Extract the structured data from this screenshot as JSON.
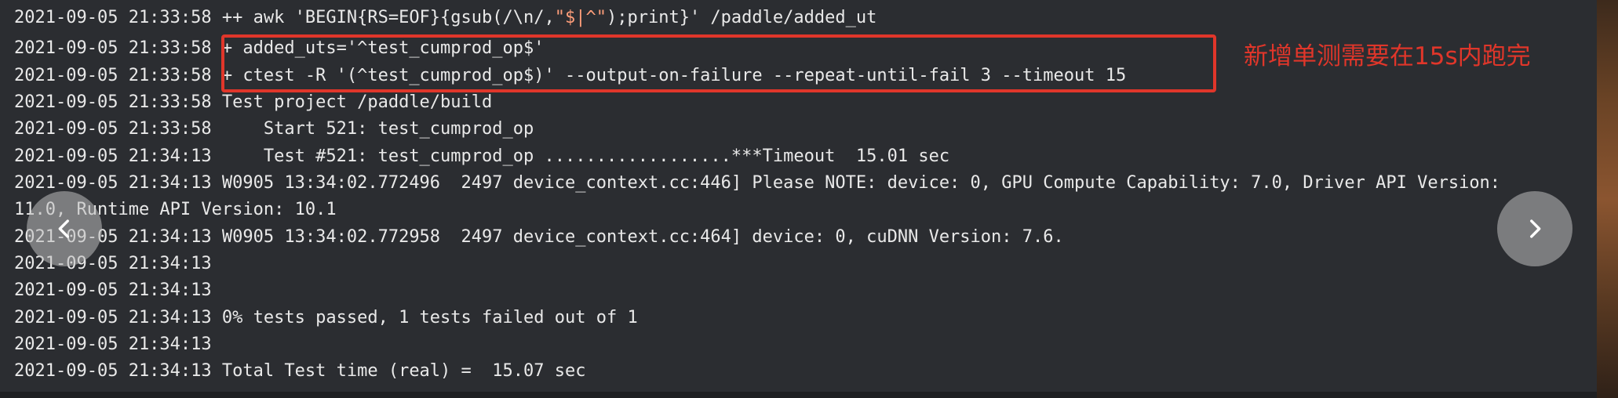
{
  "terminal": {
    "lines": [
      {
        "pre": "2021-09-05 21:33:58 ++ awk 'BEGIN{RS=EOF}{gsub(/\\n/,",
        "hl": "\"$|^\"",
        "post": ");print}' /paddle/added_ut"
      },
      {
        "pre": "2021-09-05 21:33:58 + added_uts='^test_cumprod_op$'",
        "hl": "",
        "post": ""
      },
      {
        "pre": "2021-09-05 21:33:58 + ctest -R '(^test_cumprod_op$)' --output-on-failure --repeat-until-fail 3 --timeout 15",
        "hl": "",
        "post": ""
      },
      {
        "pre": "2021-09-05 21:33:58 Test project /paddle/build",
        "hl": "",
        "post": ""
      },
      {
        "pre": "2021-09-05 21:33:58     Start 521: test_cumprod_op",
        "hl": "",
        "post": ""
      },
      {
        "pre": "2021-09-05 21:34:13     Test #521: test_cumprod_op ..................***Timeout  15.01 sec",
        "hl": "",
        "post": ""
      },
      {
        "pre": "2021-09-05 21:34:13 W0905 13:34:02.772496  2497 device_context.cc:446] Please NOTE: device: 0, GPU Compute Capability: 7.0, Driver API Version:",
        "hl": "",
        "post": ""
      },
      {
        "pre": "11.0, Runtime API Version: 10.1",
        "hl": "",
        "post": ""
      },
      {
        "pre": "2021-09-05 21:34:13 W0905 13:34:02.772958  2497 device_context.cc:464] device: 0, cuDNN Version: 7.6.",
        "hl": "",
        "post": ""
      },
      {
        "pre": "2021-09-05 21:34:13",
        "hl": "",
        "post": ""
      },
      {
        "pre": "2021-09-05 21:34:13",
        "hl": "",
        "post": ""
      },
      {
        "pre": "2021-09-05 21:34:13 0% tests passed, 1 tests failed out of 1",
        "hl": "",
        "post": ""
      },
      {
        "pre": "2021-09-05 21:34:13",
        "hl": "",
        "post": ""
      },
      {
        "pre": "2021-09-05 21:34:13 Total Test time (real) =  15.07 sec",
        "hl": "",
        "post": ""
      }
    ]
  },
  "annotation": {
    "text": "新增单测需要在15s内跑完",
    "color": "#e0362a"
  },
  "nav": {
    "prev_icon": "chevron-left-icon",
    "next_icon": "chevron-right-icon"
  }
}
